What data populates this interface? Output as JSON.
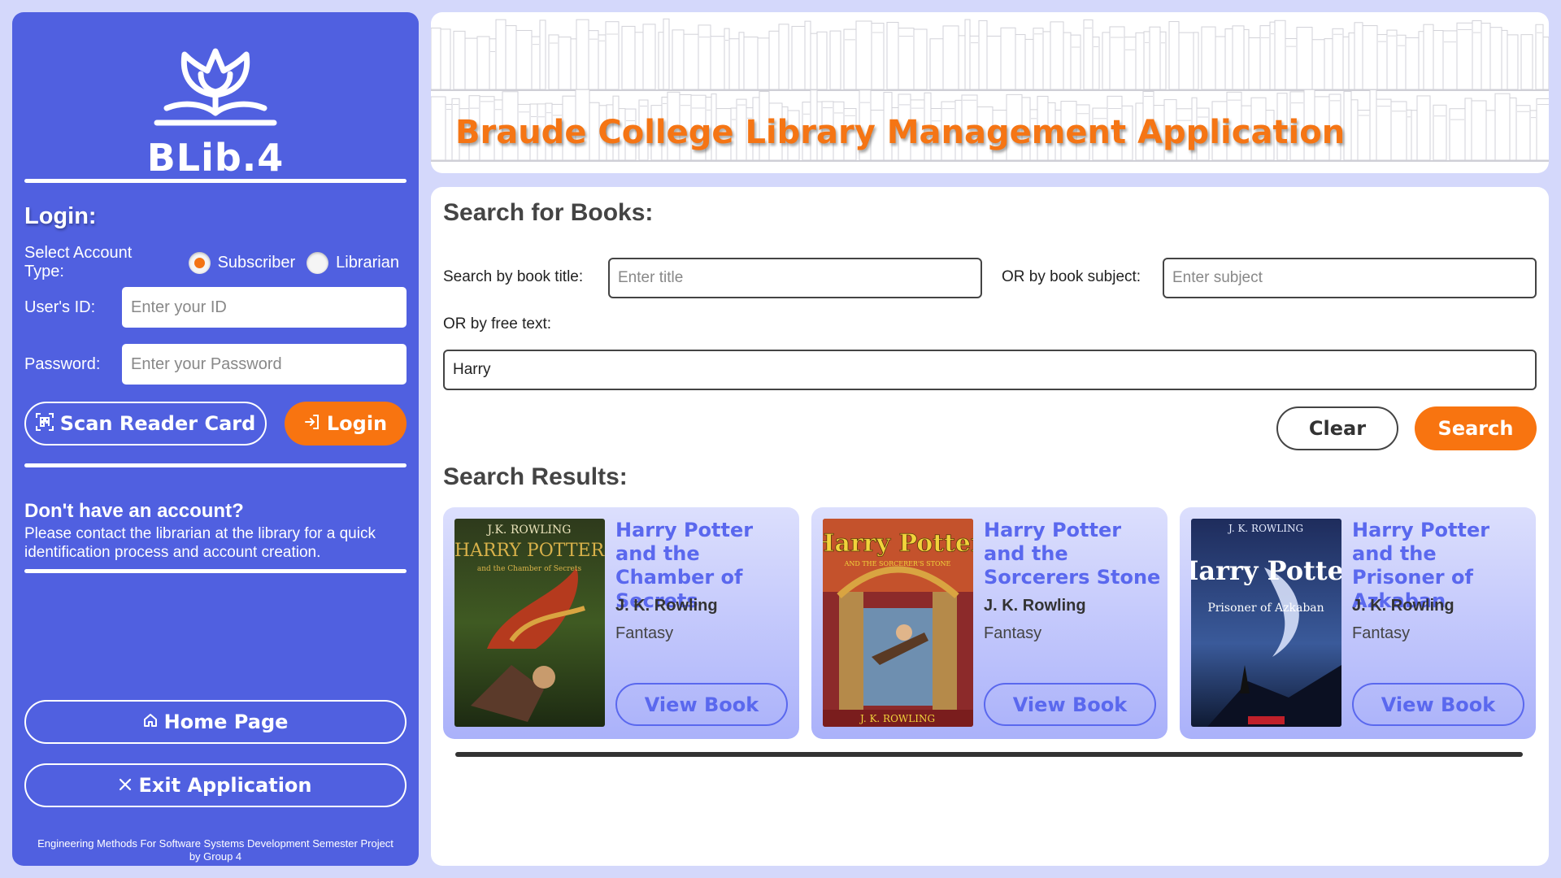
{
  "sidebar": {
    "logo_text": "BLib.4",
    "login_title": "Login:",
    "account_type_label": "Select Account Type:",
    "account_options": [
      {
        "label": "Subscriber",
        "checked": true
      },
      {
        "label": "Librarian",
        "checked": false
      }
    ],
    "user_id_label": "User's ID:",
    "user_id_placeholder": "Enter your ID",
    "password_label": "Password:",
    "password_placeholder": "Enter your Password",
    "scan_button": "Scan Reader Card",
    "login_button": "Login",
    "no_account_title": "Don't have an account?",
    "no_account_text": "Please contact the librarian at the library for a quick identification process and account creation.",
    "home_button": "Home Page",
    "exit_button": "Exit Application",
    "footer_line1": "Engineering Methods For Software Systems Development Semester Project",
    "footer_line2": "by Group 4"
  },
  "header": {
    "title": "Braude College Library Management Application"
  },
  "search": {
    "title": "Search for Books:",
    "title_label": "Search by book title:",
    "title_placeholder": "Enter title",
    "subject_label": "OR by book subject:",
    "subject_placeholder": "Enter subject",
    "free_text_label": "OR by free text:",
    "free_text_value": "Harry",
    "clear_button": "Clear",
    "search_button": "Search"
  },
  "results": {
    "title": "Search Results:",
    "view_label": "View Book",
    "books": [
      {
        "title": "Harry Potter and the Chamber of Secrets",
        "author": "J. K. Rowling",
        "genre": "Fantasy",
        "cover_author": "J.K. ROWLING",
        "cover_title": "HARRY POTTER",
        "cover_sub": "and the Chamber of Secrets"
      },
      {
        "title": "Harry Potter and the Sorcerers Stone",
        "author": "J. K. Rowling",
        "genre": "Fantasy",
        "cover_author": "J. K. ROWLING",
        "cover_title": "Harry Potter",
        "cover_sub": "AND THE SORCERER'S STONE"
      },
      {
        "title": "Harry Potter and the Prisoner of Azkaban",
        "author": "J. K. Rowling",
        "genre": "Fantasy",
        "cover_author": "J. K. ROWLING",
        "cover_title": "Harry Potter",
        "cover_sub": "Prisoner of Azkaban"
      }
    ]
  },
  "colors": {
    "sidebar_bg": "#5060e0",
    "accent_orange": "#f87410",
    "card_title_blue": "#5a68ee",
    "page_bg": "#d4d8fb"
  },
  "icons": {
    "logo": "tulip-book-icon",
    "scan": "qr-scan-icon",
    "login": "sign-in-icon",
    "home": "home-icon",
    "exit": "close-icon"
  }
}
